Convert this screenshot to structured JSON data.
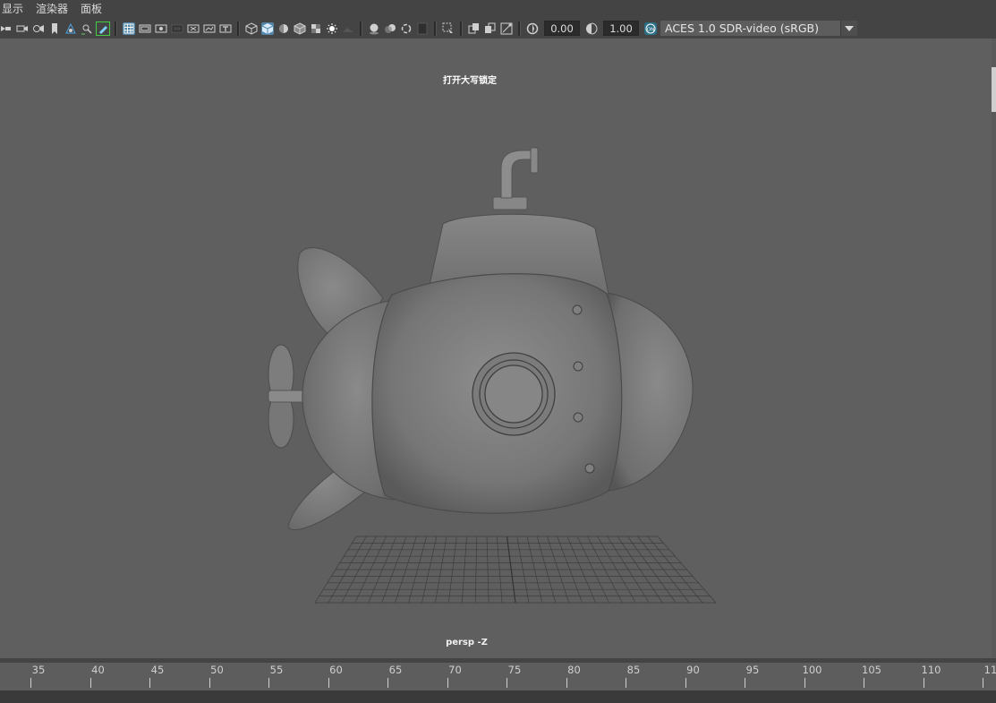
{
  "menubar": {
    "items": [
      "显示",
      "渲染器",
      "面板"
    ]
  },
  "toolbar": {
    "exposure_value": "0.00",
    "gamma_value": "1.00",
    "colorspace_label": "ACES 1.0 SDR-video (sRGB)"
  },
  "viewport": {
    "caps_lock_message": "打开大写锁定",
    "camera_label": "persp -Z",
    "object": "submarine"
  },
  "timeline": {
    "ticks": [
      "35",
      "40",
      "45",
      "50",
      "55",
      "60",
      "65",
      "70",
      "75",
      "80",
      "85",
      "90",
      "95",
      "100",
      "105",
      "110",
      "11"
    ]
  },
  "colors": {
    "viewport_bg": "#5f5f5f",
    "ui_bg": "#444444",
    "active_button": "#5285a6",
    "highlight_green": "#44cc44"
  }
}
